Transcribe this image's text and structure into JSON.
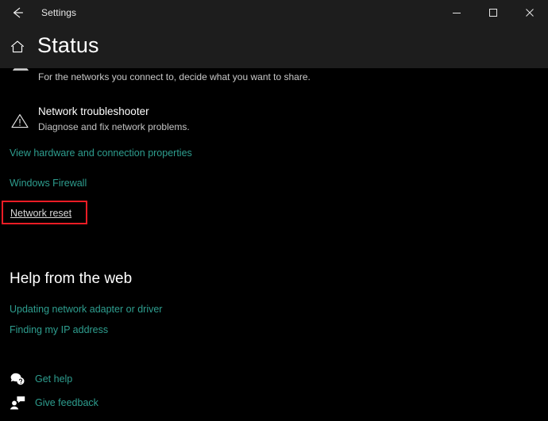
{
  "window": {
    "title": "Settings",
    "back_icon": "back-arrow-icon",
    "controls": {
      "minimize": "minimize-icon",
      "maximize": "maximize-icon",
      "close": "close-icon"
    }
  },
  "header": {
    "home_icon": "home-icon",
    "title": "Status"
  },
  "content": {
    "clipped_item": {
      "icon": "sharing-options-icon",
      "description": "For the networks you connect to, decide what you want to share."
    },
    "troubleshooter": {
      "icon": "warning-triangle-icon",
      "title": "Network troubleshooter",
      "description": "Diagnose and fix network problems."
    },
    "links": [
      {
        "label": "View hardware and connection properties"
      },
      {
        "label": "Windows Firewall"
      }
    ],
    "network_reset": {
      "label": "Network reset",
      "highlighted": true,
      "highlight_color": "#ef1c25"
    },
    "help_section": {
      "heading": "Help from the web",
      "links": [
        {
          "label": "Updating network adapter or driver"
        },
        {
          "label": "Finding my IP address"
        }
      ]
    },
    "footer_actions": [
      {
        "icon": "get-help-icon",
        "label": "Get help"
      },
      {
        "icon": "give-feedback-icon",
        "label": "Give feedback"
      }
    ]
  },
  "colors": {
    "titlebar_bg": "#1d1d1d",
    "content_bg": "#000000",
    "link": "#2e9e8f",
    "text_primary": "#ffffff",
    "text_secondary": "#c4c4c4",
    "highlight": "#ef1c25"
  }
}
